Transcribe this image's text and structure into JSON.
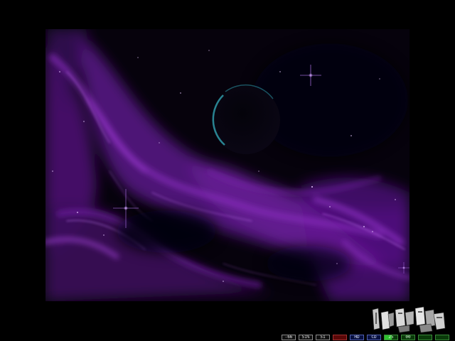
{
  "hud": {
    "cells": [
      {
        "id": "cell-1",
        "text": "-66"
      },
      {
        "id": "cell-2",
        "text": "51%"
      },
      {
        "id": "cell-3",
        "text": "51"
      },
      {
        "id": "cell-4",
        "text": ""
      },
      {
        "id": "cell-5",
        "text": "HD"
      },
      {
        "id": "cell-6",
        "text": "CD"
      },
      {
        "id": "cell-7",
        "text": "25"
      },
      {
        "id": "cell-8",
        "text": "00"
      }
    ],
    "meter_fill": 0.55
  },
  "colors": {
    "nebula": "#7a1fb0",
    "nebula_deep": "#3b0a5a",
    "planet_rim": "#2f9aa8",
    "star": "#e6c8ff"
  },
  "icons": {
    "logo": "intro-logo-icon",
    "planet": "planet-icon",
    "star": "star-icon"
  }
}
